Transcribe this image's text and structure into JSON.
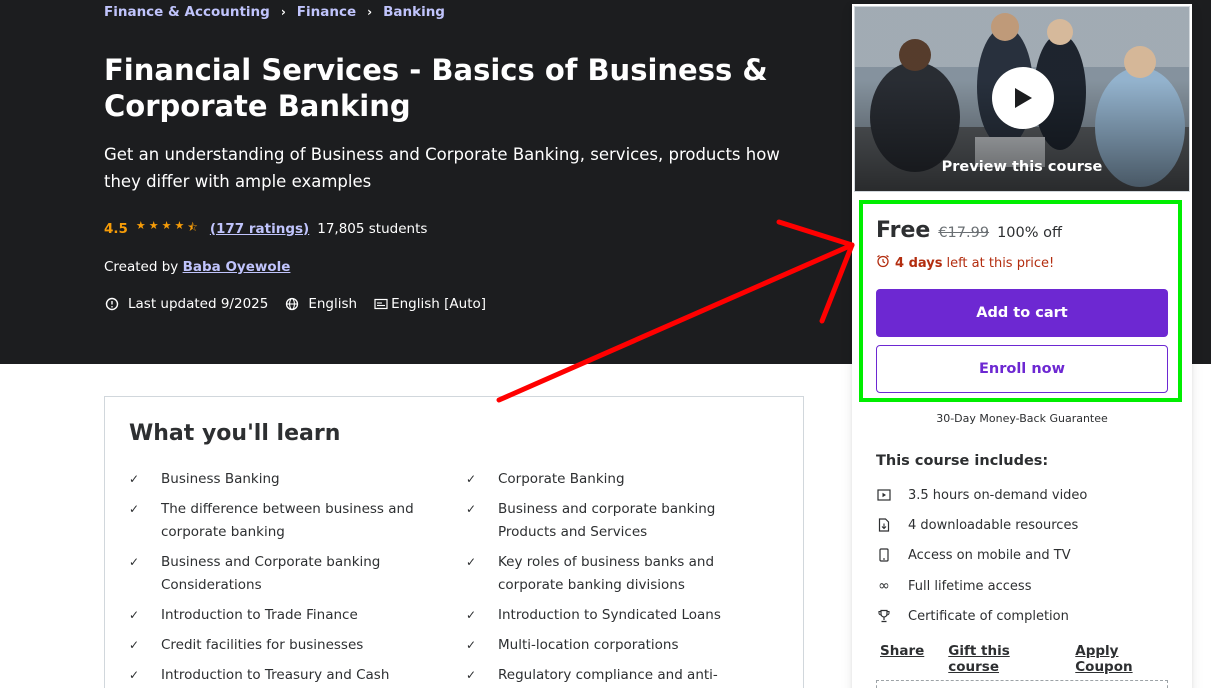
{
  "breadcrumb": [
    "Finance & Accounting",
    "Finance",
    "Banking"
  ],
  "course": {
    "title": "Financial Services - Basics of Business & Corporate Banking",
    "subtitle": "Get an understanding of Business and Corporate Banking, services, products how they differ with ample examples",
    "rating": "4.5",
    "rating_stars": 4.5,
    "ratings_count": "(177 ratings)",
    "students": "17,805 students",
    "created_by_label": "Created by",
    "instructor": "Baba Oyewole",
    "last_updated": "Last updated 9/2025",
    "language": "English",
    "captions": "English [Auto]"
  },
  "learn": {
    "title": "What you'll learn",
    "items": [
      "Business Banking",
      "Corporate Banking",
      "The difference between business and corporate banking",
      "Business and corporate banking Products and Services",
      "Business and Corporate banking Considerations",
      "Key roles of business banks and corporate banking divisions",
      "Introduction to Trade Finance",
      "Introduction to Syndicated Loans",
      "Credit facilities for businesses",
      "Multi-location corporations",
      "Introduction to Treasury and Cash",
      "Regulatory compliance and anti-money"
    ]
  },
  "sidebar": {
    "preview_label": "Preview this course",
    "price": "Free",
    "original_price": "€17.99",
    "discount": "100% off",
    "timer_bold": "4 days",
    "timer_rest": "left at this price!",
    "add_to_cart": "Add to cart",
    "enroll_now": "Enroll now",
    "guarantee": "30-Day Money-Back Guarantee",
    "includes_title": "This course includes:",
    "includes": [
      {
        "icon": "video-icon",
        "text": "3.5 hours on-demand video"
      },
      {
        "icon": "download-file-icon",
        "text": "4 downloadable resources"
      },
      {
        "icon": "mobile-icon",
        "text": "Access on mobile and TV"
      },
      {
        "icon": "infinity-icon",
        "text": "Full lifetime access"
      },
      {
        "icon": "trophy-icon",
        "text": "Certificate of completion"
      }
    ],
    "actions": [
      "Share",
      "Gift this course",
      "Apply Coupon"
    ]
  },
  "colors": {
    "hero_bg": "#1c1d1f",
    "link_purple": "#c0c4fc",
    "star": "#f69c08",
    "primary": "#6d28d2",
    "timer_red": "#b32d0f",
    "highlight_green": "#00ee00",
    "annotation_arrow": "#ff0000"
  }
}
